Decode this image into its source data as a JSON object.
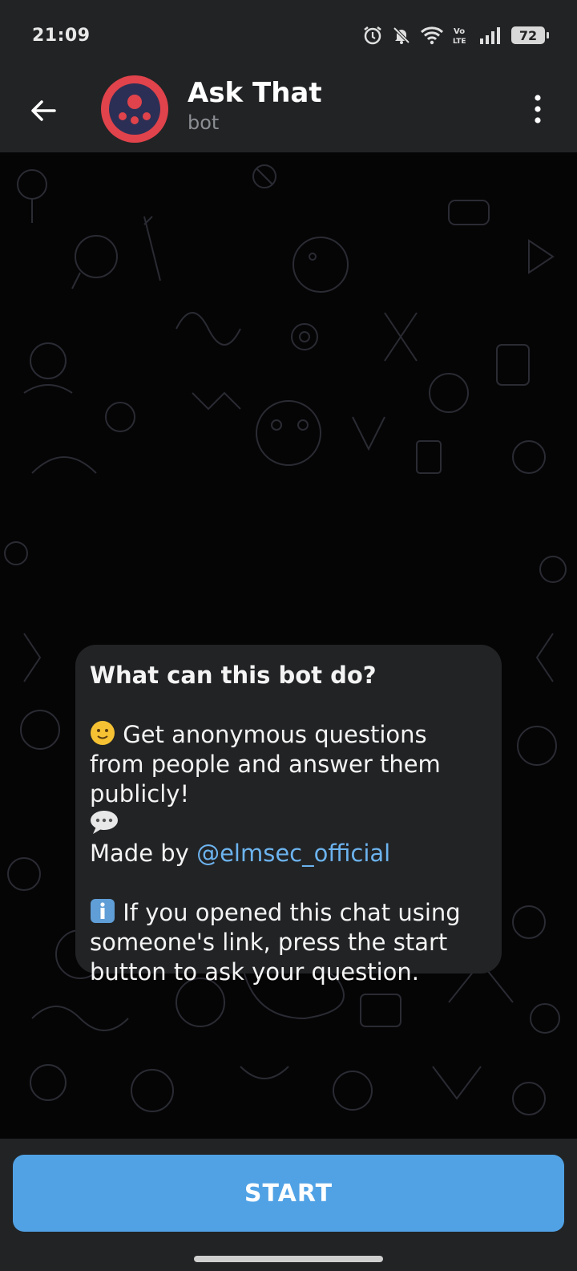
{
  "status_bar": {
    "time": "21:09",
    "icons": [
      "alarm-icon",
      "mute-icon",
      "wifi-icon",
      "volte-icon",
      "signal-icon"
    ],
    "battery": "72"
  },
  "header": {
    "title": "Ask That",
    "subtitle": "bot",
    "avatar_color": "#e0434b",
    "avatar_bg": "#2c2f55"
  },
  "message": {
    "heading": "What can this bot do?",
    "line1": "Get anonymous questions from people and answer them publicly!",
    "made_by_prefix": "Made by ",
    "made_by_link": "@elmsec_official",
    "line2": "If you opened this chat using someone's link, press the start button to ask your question.",
    "emoji_1": "slight-smile-emoji",
    "emoji_2": "speech-balloon-emoji",
    "emoji_3": "information-emoji"
  },
  "footer": {
    "start_label": "START",
    "accent": "#50a2e5"
  }
}
